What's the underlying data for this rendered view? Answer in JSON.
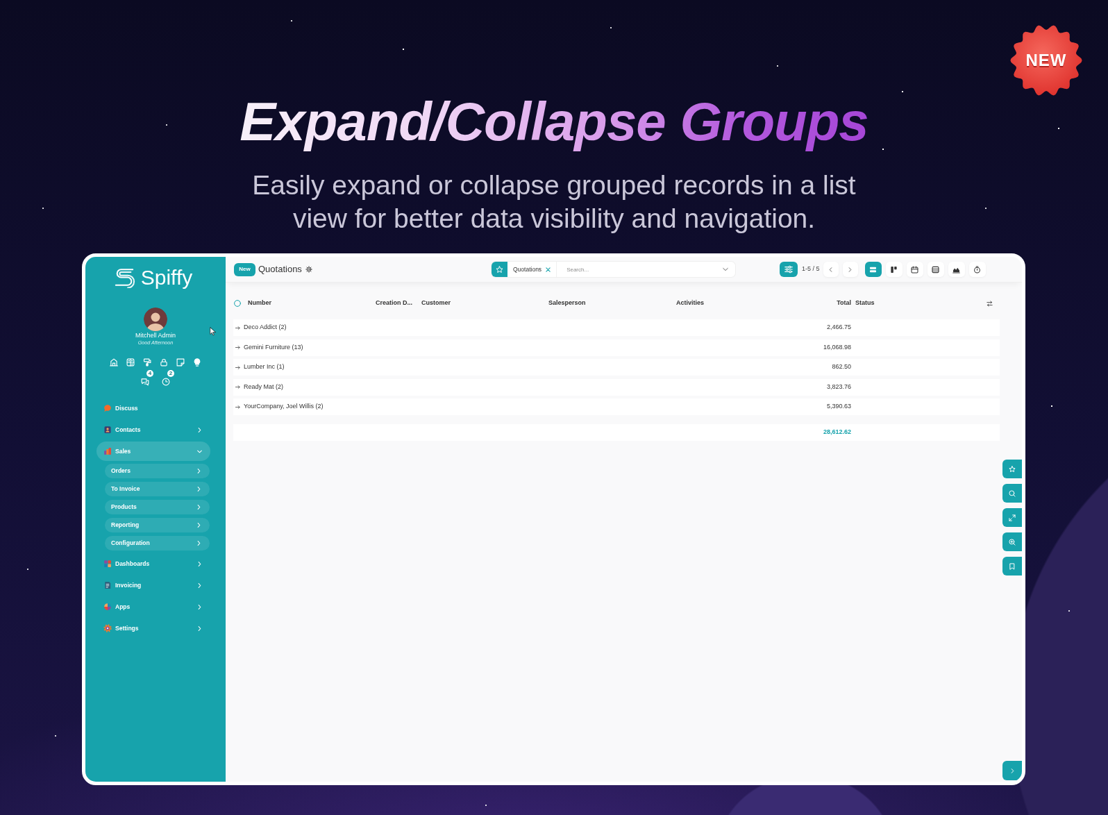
{
  "promo": {
    "badge": "NEW",
    "title": "Expand/Collapse Groups",
    "subtitle": "Easily expand or collapse grouped records in a list view for better data visibility and navigation."
  },
  "sidebar": {
    "logo": "Spiffy",
    "user": {
      "name": "Mitchell Admin",
      "greeting": "Good Afternoon"
    },
    "notifications": [
      {
        "kind": "chat",
        "count": "4"
      },
      {
        "kind": "activity",
        "count": "2"
      }
    ],
    "menu": [
      {
        "label": "Discuss",
        "kind": "link",
        "expanded": false
      },
      {
        "label": "Contacts",
        "kind": "folder",
        "expanded": false
      },
      {
        "label": "Sales",
        "kind": "folder",
        "expanded": true,
        "children": [
          {
            "label": "Orders"
          },
          {
            "label": "To Invoice"
          },
          {
            "label": "Products"
          },
          {
            "label": "Reporting"
          },
          {
            "label": "Configuration"
          }
        ]
      },
      {
        "label": "Dashboards",
        "kind": "folder",
        "expanded": false
      },
      {
        "label": "Invoicing",
        "kind": "folder",
        "expanded": false
      },
      {
        "label": "Apps",
        "kind": "folder",
        "expanded": false
      },
      {
        "label": "Settings",
        "kind": "folder",
        "expanded": false
      }
    ]
  },
  "control_panel": {
    "new_button": "New",
    "breadcrumb": "Quotations",
    "search": {
      "facet": "Quotations",
      "placeholder": "Search..."
    },
    "pager": "1-5 / 5",
    "views": [
      {
        "kind": "list",
        "selected": true
      },
      {
        "kind": "kanban",
        "selected": false
      },
      {
        "kind": "calendar",
        "selected": false
      },
      {
        "kind": "pivot",
        "selected": false
      },
      {
        "kind": "graph",
        "selected": false
      },
      {
        "kind": "activity",
        "selected": false
      }
    ]
  },
  "table": {
    "select_all": {
      "checked": false
    },
    "columns": [
      "Number",
      "Creation D...",
      "Customer",
      "Salesperson",
      "Activities",
      "Total",
      "Status"
    ],
    "groups": [
      {
        "name": "Deco Addict (2)",
        "total": "2,466.75",
        "expanded": false
      },
      {
        "name": "Gemini Furniture (13)",
        "total": "16,068.98",
        "expanded": false
      },
      {
        "name": "Lumber Inc (1)",
        "total": "862.50",
        "expanded": false
      },
      {
        "name": "Ready Mat (2)",
        "total": "3,823.76",
        "expanded": false
      },
      {
        "name": "YourCompany, Joel Willis (2)",
        "total": "5,390.63",
        "expanded": false
      }
    ],
    "grand_total": "28,612.62"
  }
}
